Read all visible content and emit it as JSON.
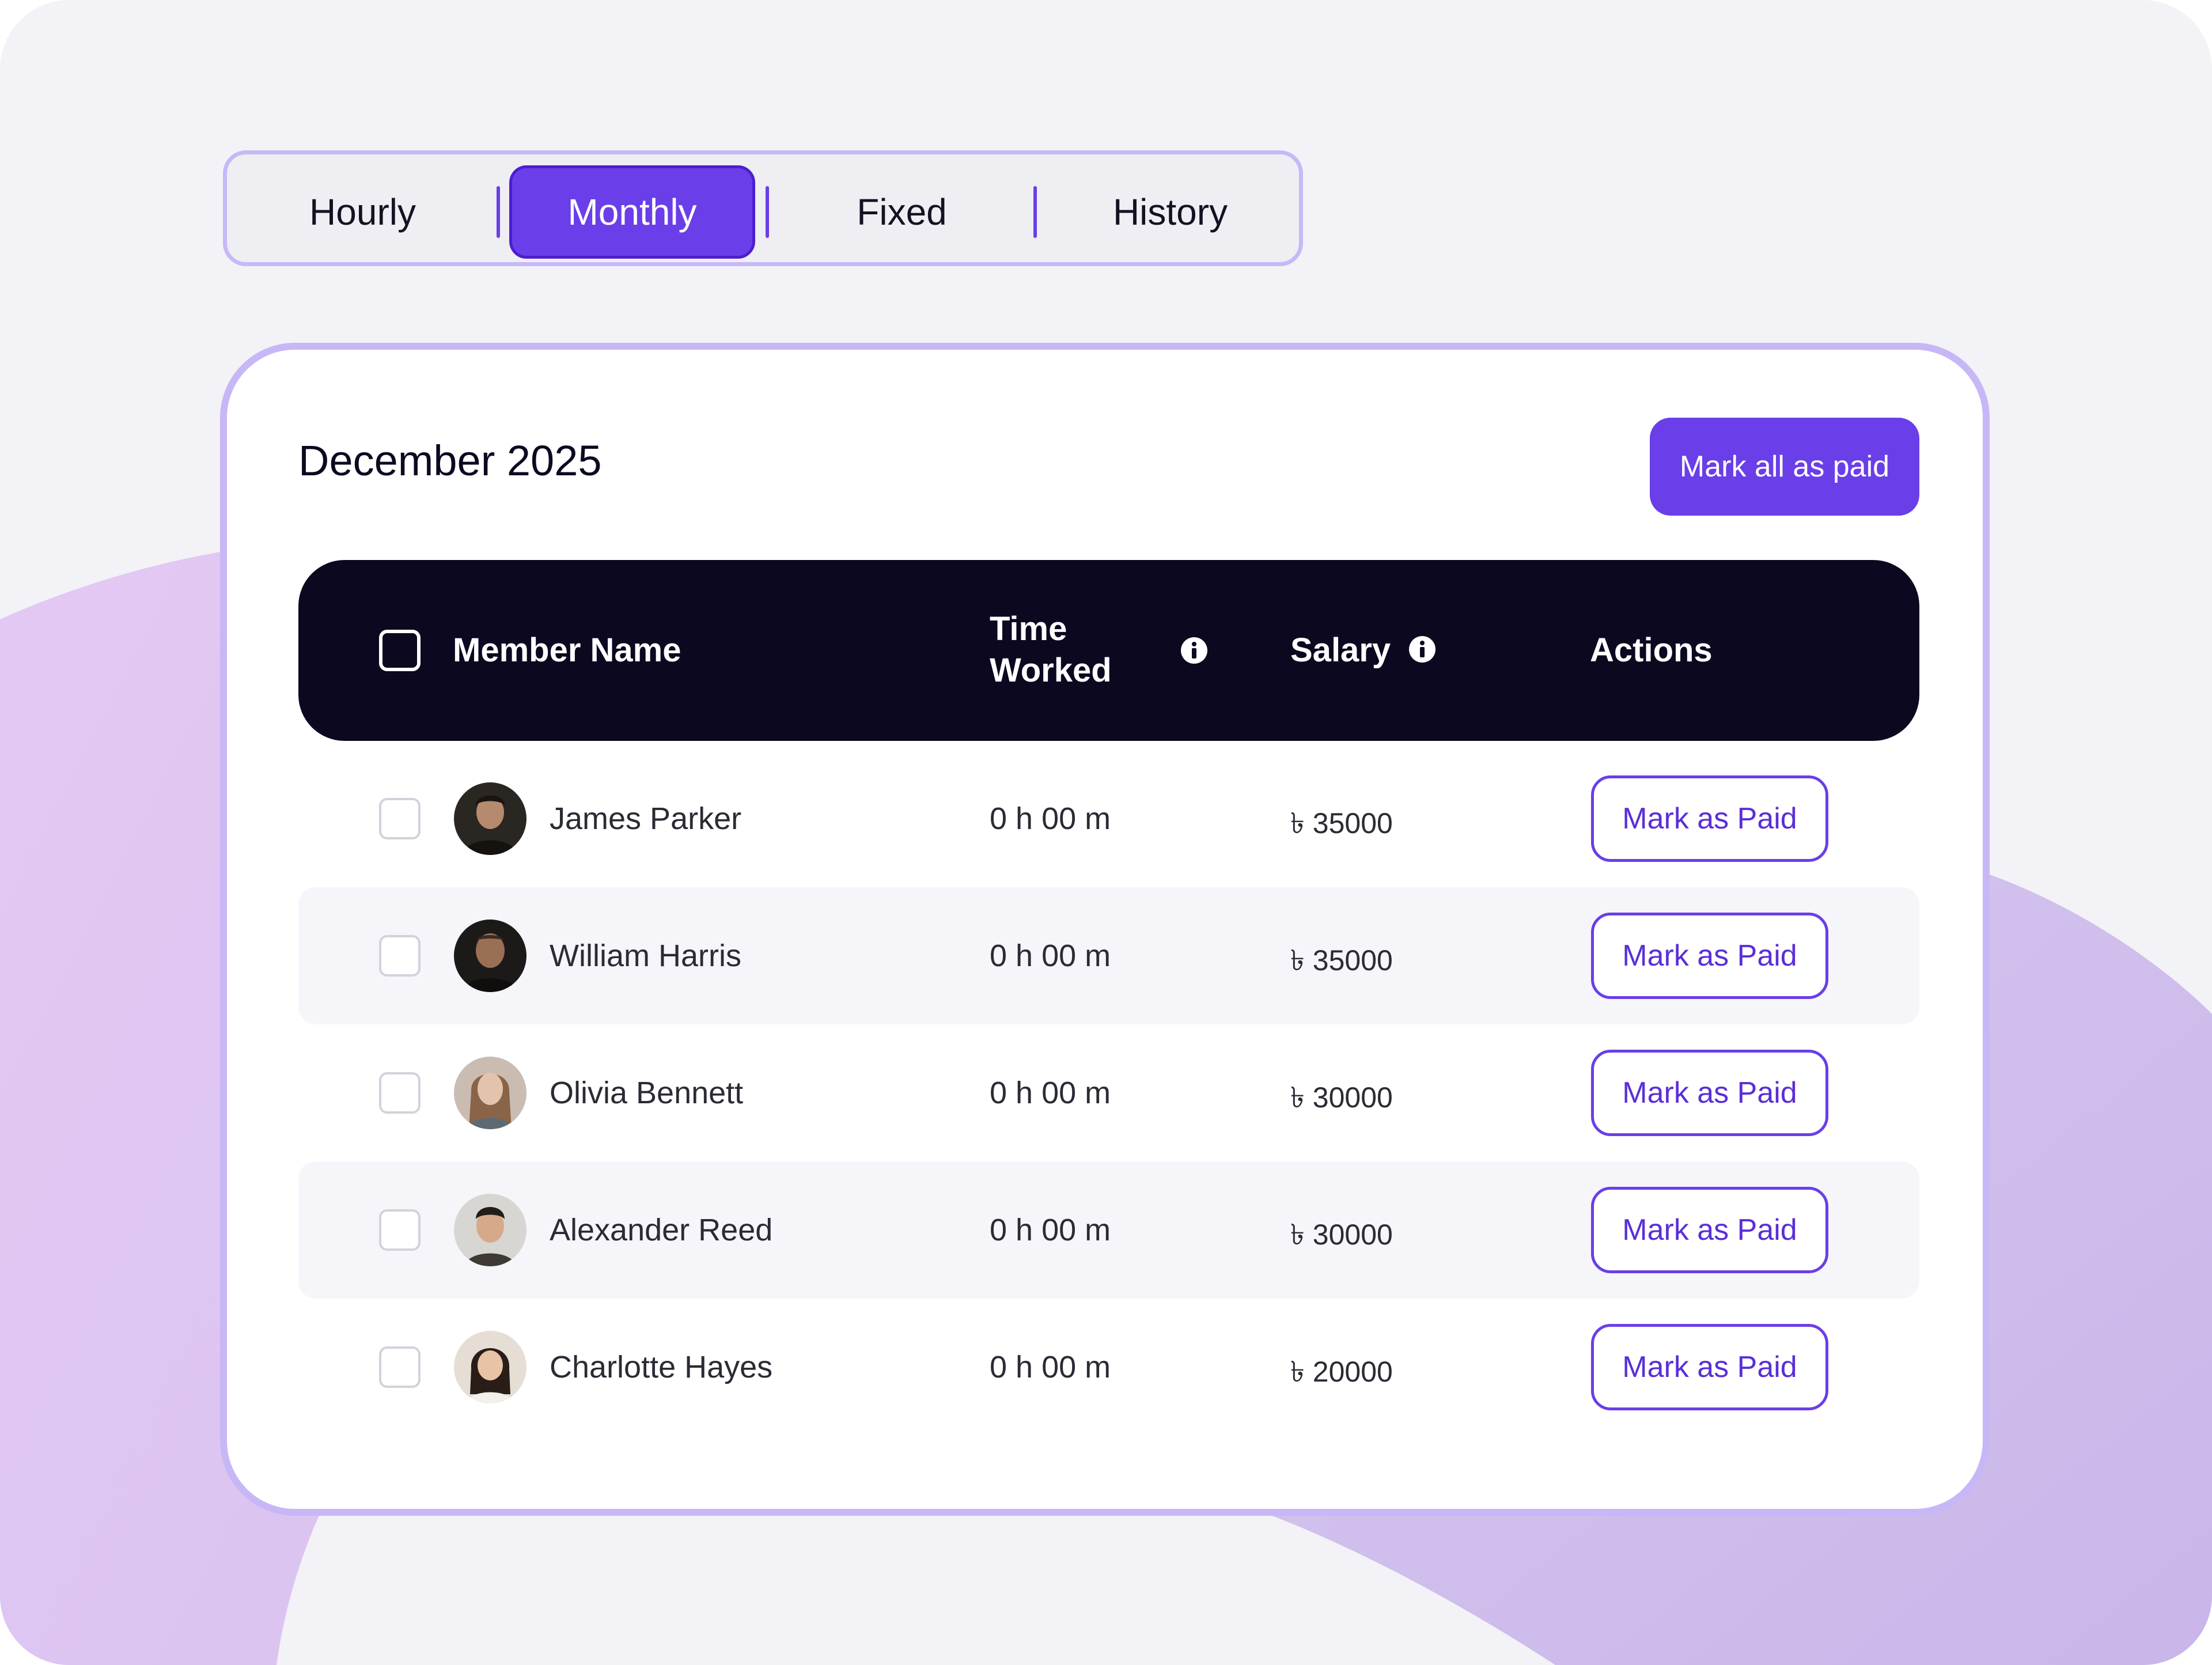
{
  "tabs": [
    {
      "label": "Hourly",
      "active": false
    },
    {
      "label": "Monthly",
      "active": true
    },
    {
      "label": "Fixed",
      "active": false
    },
    {
      "label": "History",
      "active": false
    }
  ],
  "card": {
    "title": "December 2025",
    "mark_all_label": "Mark all as paid"
  },
  "table": {
    "headers": {
      "member_name": "Member Name",
      "time_worked_line1": "Time",
      "time_worked_line2": "Worked",
      "salary": "Salary",
      "actions": "Actions"
    },
    "rows": [
      {
        "name": "James Parker",
        "time": "0 h 00 m",
        "salary": "৳ 35000",
        "action": "Mark as Paid"
      },
      {
        "name": "William Harris",
        "time": "0 h 00 m",
        "salary": "৳ 35000",
        "action": "Mark as Paid"
      },
      {
        "name": "Olivia Bennett",
        "time": "0 h 00 m",
        "salary": "৳ 30000",
        "action": "Mark as Paid"
      },
      {
        "name": "Alexander Reed",
        "time": "0 h 00 m",
        "salary": "৳ 30000",
        "action": "Mark as Paid"
      },
      {
        "name": "Charlotte Hayes",
        "time": "0 h 00 m",
        "salary": "৳ 20000",
        "action": "Mark as Paid"
      }
    ]
  },
  "colors": {
    "accent": "#6a3ee8",
    "header_bg": "#0b0820",
    "card_border": "#c8b7f6",
    "page_bg": "#f3f2f7"
  }
}
